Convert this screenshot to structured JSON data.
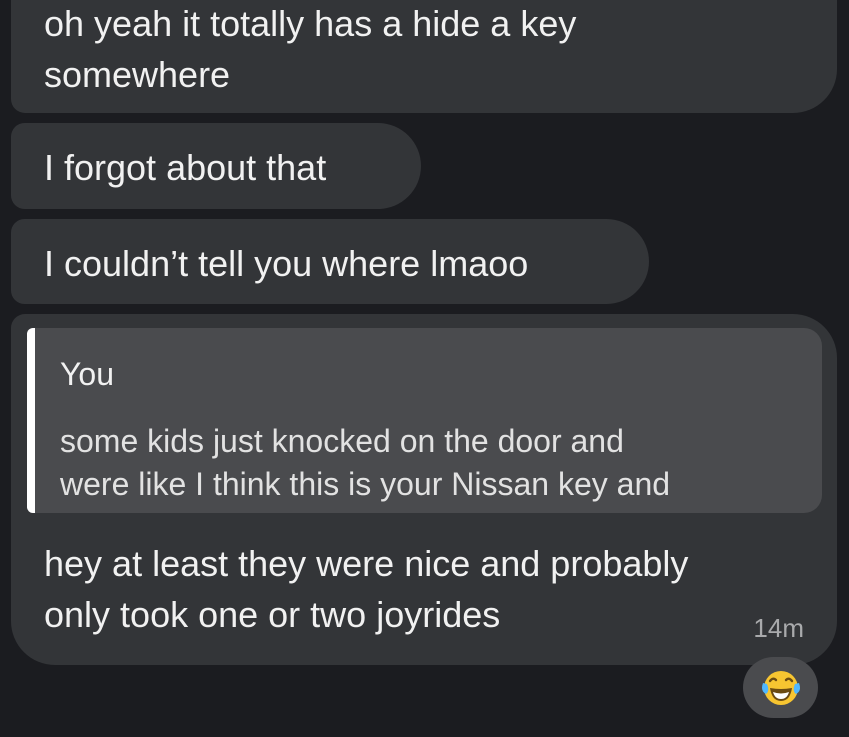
{
  "messages": [
    {
      "id": "msg-1",
      "text": "oh yeah it totally has a hide a key\nsomewhere"
    },
    {
      "id": "msg-2",
      "text": "I forgot about that"
    },
    {
      "id": "msg-3",
      "text": "I couldn’t tell you where lmaoo"
    },
    {
      "id": "msg-4",
      "quote": {
        "author": "You",
        "text": "some kids just knocked on the door and\nwere like I think this is your Nissan key and"
      },
      "text": "hey at least they were nice and probably\nonly took one or two joyrides",
      "timestamp": "14m",
      "reaction": {
        "icon": "laughing-with-tears-emoji-icon",
        "count_visible": false
      }
    }
  ],
  "colors": {
    "background": "#1b1c20",
    "bubble": "#333538",
    "quote_background": "#4a4b4e",
    "quote_bar": "#ffffff",
    "text": "#f1f1f1",
    "timestamp": "#a9aaac"
  }
}
